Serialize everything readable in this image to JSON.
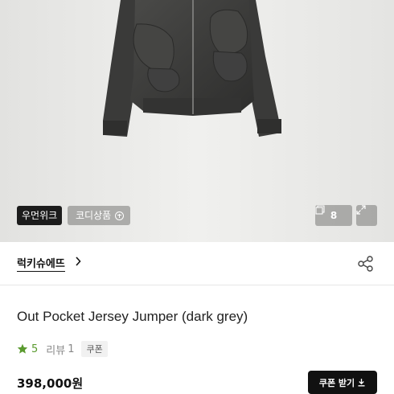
{
  "hero": {
    "brand_tag": "우먼위크",
    "coordi_label": "코디상품",
    "image_count": "8"
  },
  "brand": {
    "name": "럭키슈에뜨"
  },
  "product": {
    "title": "Out Pocket Jersey Jumper (dark grey)",
    "rating": "5",
    "review_label": "리뷰",
    "review_count": "1",
    "coupon_tag": "쿠폰",
    "price": "398,000원",
    "coupon_button": "쿠폰 받기"
  },
  "colors": {
    "accent_green": "#5a9a2e",
    "button_dark": "#111111"
  }
}
